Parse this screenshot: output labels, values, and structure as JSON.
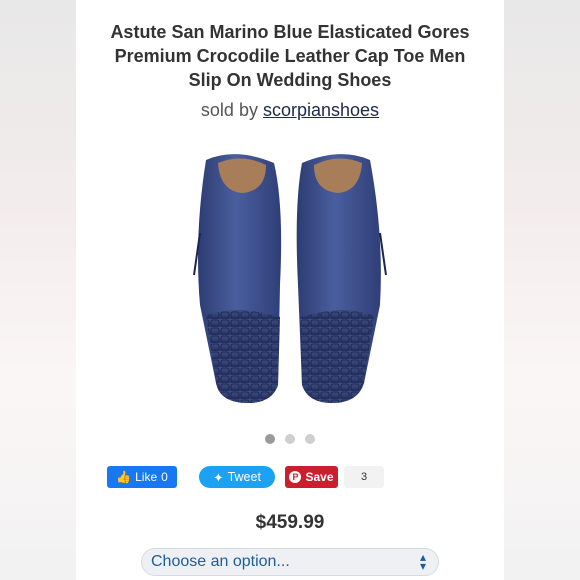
{
  "product": {
    "title_line1": "Astute San Marino Blue Elasticated Gores",
    "title_line2": "Premium Crocodile Leather Cap Toe Men",
    "title_line3": "Slip On Wedding Shoes",
    "sold_by_prefix": "sold by",
    "seller": "scorpianshoes",
    "price": "$459.99"
  },
  "gallery": {
    "dots": 3,
    "active_index": 0
  },
  "social": {
    "like_label": "Like",
    "like_count": "0",
    "tweet_label": "Tweet",
    "save_label": "Save",
    "save_count": "3"
  },
  "options": {
    "select_label": "Choose an option..."
  },
  "colors": {
    "shoe_blue": "#3a4d8c",
    "facebook": "#1877f2",
    "twitter": "#1da1f2",
    "pinterest": "#cb1f2d"
  },
  "icons": [
    "facebook-thumb-icon",
    "twitter-bird-icon",
    "pinterest-icon",
    "chevron-updown-icon"
  ]
}
